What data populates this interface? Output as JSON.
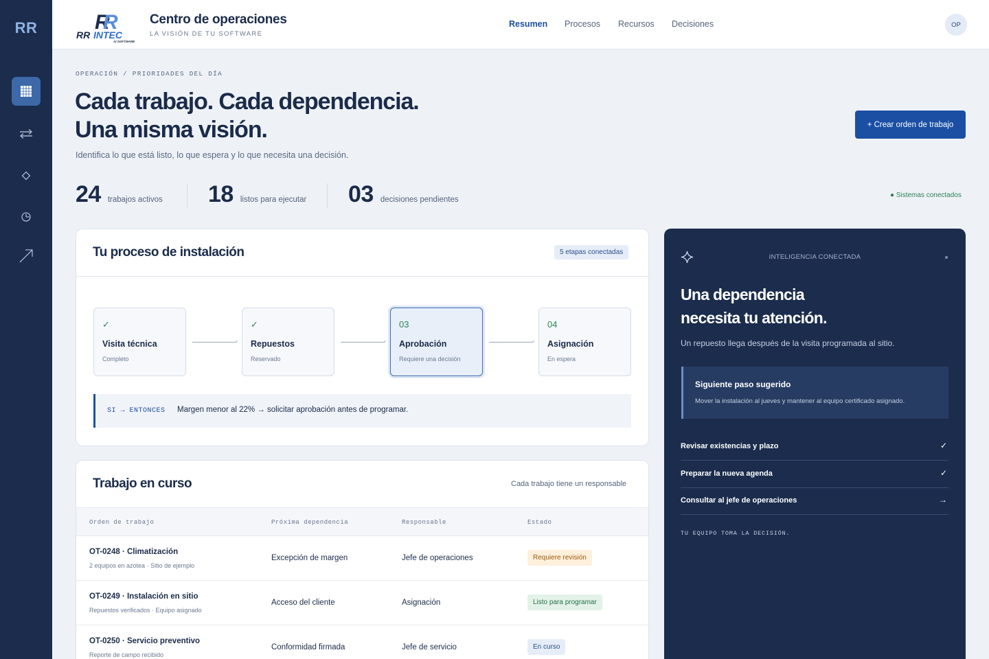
{
  "rail": {
    "logo": "RR",
    "items": [
      {
        "icon": "grid-icon",
        "active": true
      },
      {
        "icon": "swap-arrows-icon",
        "active": false
      },
      {
        "icon": "diamond-icon",
        "active": false
      },
      {
        "icon": "clock-icon",
        "active": false
      },
      {
        "icon": "trend-arrow-icon",
        "active": false
      }
    ]
  },
  "header": {
    "logo_text": "RR INTEC",
    "logo_tagline": "AI SOFTWARE",
    "title": "Centro de operaciones",
    "subtitle": "LA VISIÓN DE TU SOFTWARE",
    "nav": [
      {
        "label": "Resumen",
        "active": true
      },
      {
        "label": "Procesos",
        "active": false
      },
      {
        "label": "Recursos",
        "active": false
      },
      {
        "label": "Decisiones",
        "active": false
      }
    ],
    "avatar": "OP"
  },
  "hero": {
    "breadcrumb": "OPERACIÓN / PRIORIDADES DEL DÍA",
    "title_line1": "Cada trabajo. Cada dependencia.",
    "title_line2": "Una misma visión.",
    "subtitle": "Identifica lo que está listo, lo que espera y lo que necesita una decisión.",
    "cta": "+ Crear orden de trabajo"
  },
  "stats": [
    {
      "value": "24",
      "label": "trabajos activos"
    },
    {
      "value": "18",
      "label": "listos para ejecutar"
    },
    {
      "value": "03",
      "label": "decisiones pendientes"
    }
  ],
  "status": "● Sistemas conectados",
  "process": {
    "title": "Tu proceso de instalación",
    "badge": "5 etapas conectadas",
    "steps": [
      {
        "marker": "✓",
        "name": "Visita técnica",
        "status": "Completo"
      },
      {
        "marker": "✓",
        "name": "Repuestos",
        "status": "Reservado"
      },
      {
        "marker": "03",
        "name": "Aprobación",
        "status": "Requiere una decisión"
      },
      {
        "marker": "04",
        "name": "Asignación",
        "status": "En espera"
      }
    ],
    "rule_tag": "SI → ENTONCES",
    "rule_text": "Margen menor al 22% → solicitar aprobación antes de programar."
  },
  "work": {
    "title": "Trabajo en curso",
    "note": "Cada trabajo tiene un responsable",
    "columns": [
      "Orden de trabajo",
      "Próxima dependencia",
      "Responsable",
      "Estado"
    ],
    "rows": [
      {
        "title": "OT-0248 · Climatización",
        "sub": "2 equipos en azotea · Sitio de ejemplo",
        "dependency": "Excepción de margen",
        "owner": "Jefe de operaciones",
        "status": "Requiere revisión",
        "status_color": "#f0a030"
      },
      {
        "title": "OT-0249 · Instalación en sitio",
        "sub": "Repuestos verificados · Equipo asignado",
        "dependency": "Acceso del cliente",
        "owner": "Asignación",
        "status": "Listo para programar",
        "status_color": "#2e8556"
      },
      {
        "title": "OT-0250 · Servicio preventivo",
        "sub": "Reporte de campo recibido",
        "dependency": "Conformidad firmada",
        "owner": "Jefe de servicio",
        "status": "En curso",
        "status_color": "#1c4fa0"
      }
    ]
  },
  "panel": {
    "kicker": "INTELIGENCIA CONECTADA",
    "title_line1": "Una dependencia",
    "title_line2": "necesita tu atención.",
    "subtitle": "Un repuesto llega después de la visita programada al sitio.",
    "suggest_title": "Siguiente paso sugerido",
    "suggest_desc": "Mover la instalación al jueves y mantener al equipo certificado asignado.",
    "tasks": [
      {
        "label": "Revisar existencias y plazo",
        "mark": "✓"
      },
      {
        "label": "Preparar la nueva agenda",
        "mark": "✓"
      },
      {
        "label": "Consultar al jefe de operaciones",
        "mark": "→"
      }
    ],
    "footer": "TU EQUIPO TOMA LA DECISIÓN."
  }
}
